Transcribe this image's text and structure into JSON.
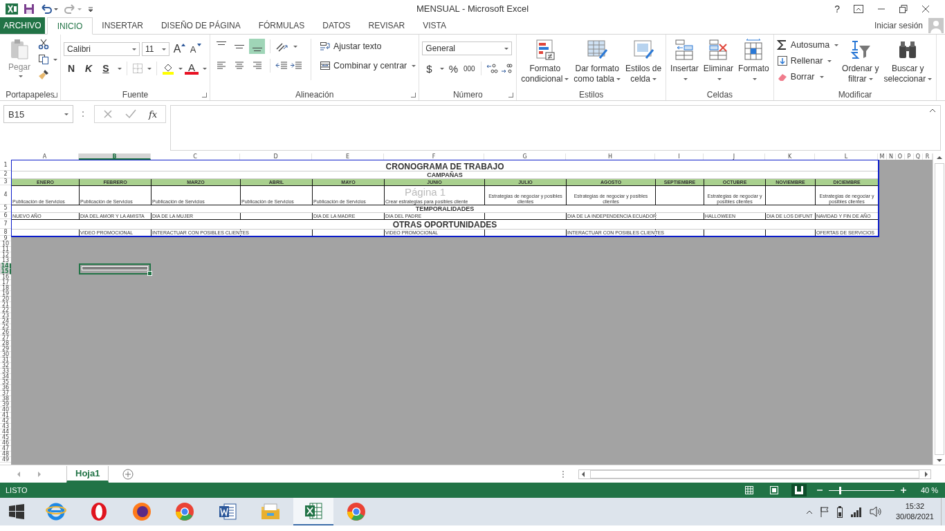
{
  "title_bar": {
    "title": "MENSUAL - Microsoft Excel",
    "help": "?"
  },
  "tabs": [
    {
      "label": "ARCHIVO",
      "kind": "file",
      "selected": false
    },
    {
      "label": "INICIO",
      "kind": "tab",
      "selected": true
    },
    {
      "label": "INSERTAR",
      "kind": "tab",
      "selected": false
    },
    {
      "label": "DISEÑO DE PÁGINA",
      "kind": "tab",
      "selected": false
    },
    {
      "label": "FÓRMULAS",
      "kind": "tab",
      "selected": false
    },
    {
      "label": "DATOS",
      "kind": "tab",
      "selected": false
    },
    {
      "label": "REVISAR",
      "kind": "tab",
      "selected": false
    },
    {
      "label": "VISTA",
      "kind": "tab",
      "selected": false
    }
  ],
  "account": {
    "label": "Iniciar sesión"
  },
  "ribbon": {
    "clipboard": {
      "paste": "Pegar",
      "label": "Portapapeles"
    },
    "font": {
      "family": "Calibri",
      "size": "11",
      "grow": "A",
      "shrink": "A",
      "styles": [
        "N",
        "K",
        "S"
      ],
      "color_letter": "A",
      "label": "Fuente"
    },
    "alignment": {
      "buttons": [
        {
          "kind": "top",
          "selected": false
        },
        {
          "kind": "middle",
          "selected": false
        },
        {
          "kind": "bottom",
          "selected": true
        },
        {
          "kind": "left",
          "selected": false
        },
        {
          "kind": "center",
          "selected": false
        },
        {
          "kind": "right",
          "selected": false
        }
      ],
      "wrap": "Ajustar texto",
      "merge": "Combinar y centrar",
      "label": "Alineación"
    },
    "number": {
      "format": "General",
      "buttons": [
        "$",
        "%",
        "000"
      ],
      "label": "Número"
    },
    "styles": {
      "buttons": [
        {
          "kind": "conditional",
          "lines": [
            "Formato",
            "condicional"
          ]
        },
        {
          "kind": "table",
          "lines": [
            "Dar formato",
            "como tabla"
          ]
        },
        {
          "kind": "cell",
          "lines": [
            "Estilos de",
            "celda"
          ]
        }
      ],
      "label": "Estilos"
    },
    "cells": {
      "buttons": [
        {
          "kind": "insert",
          "label": "Insertar"
        },
        {
          "kind": "delete",
          "label": "Eliminar"
        },
        {
          "kind": "format",
          "label": "Formato"
        }
      ],
      "label": "Celdas"
    },
    "editing": {
      "small": [
        {
          "kind": "sum",
          "label": "Autosuma"
        },
        {
          "kind": "fill",
          "label": "Rellenar"
        },
        {
          "kind": "clear",
          "label": "Borrar"
        }
      ],
      "big": [
        {
          "kind": "sort",
          "lines": [
            "Ordenar y",
            "filtrar"
          ]
        },
        {
          "kind": "find",
          "lines": [
            "Buscar y",
            "seleccionar"
          ]
        }
      ],
      "label": "Modificar"
    }
  },
  "formula_bar": {
    "name_box": "B15",
    "fx": "fx"
  },
  "sheet": {
    "columns": [
      {
        "label": "A",
        "selected": false
      },
      {
        "label": "B",
        "selected": true
      },
      {
        "label": "C",
        "selected": false
      },
      {
        "label": "D",
        "selected": false
      },
      {
        "label": "E",
        "selected": false
      },
      {
        "label": "F",
        "selected": false
      },
      {
        "label": "G",
        "selected": false
      },
      {
        "label": "H",
        "selected": false
      },
      {
        "label": "I",
        "selected": false
      },
      {
        "label": "J",
        "selected": false
      },
      {
        "label": "K",
        "selected": false
      },
      {
        "label": "L",
        "selected": false
      },
      {
        "label": "M",
        "selected": false
      },
      {
        "label": "N",
        "selected": false
      },
      {
        "label": "O",
        "selected": false
      },
      {
        "label": "P",
        "selected": false
      },
      {
        "label": "Q",
        "selected": false
      },
      {
        "label": "R",
        "selected": false
      }
    ],
    "row_numbers": [
      {
        "label": "1",
        "selected": false
      },
      {
        "label": "2",
        "selected": false
      },
      {
        "label": "3",
        "selected": false
      },
      {
        "label": "4",
        "selected": false
      },
      {
        "label": "5",
        "selected": false
      },
      {
        "label": "6",
        "selected": false
      },
      {
        "label": "7",
        "selected": false
      },
      {
        "label": "8",
        "selected": false
      },
      {
        "label": "9",
        "selected": false
      },
      {
        "label": "10",
        "selected": false
      },
      {
        "label": "11",
        "selected": false
      },
      {
        "label": "12",
        "selected": false
      },
      {
        "label": "13",
        "selected": false
      },
      {
        "label": "14",
        "selected": true
      },
      {
        "label": "15",
        "selected": true
      },
      {
        "label": "16",
        "selected": false
      },
      {
        "label": "17",
        "selected": false
      },
      {
        "label": "18",
        "selected": false
      },
      {
        "label": "19",
        "selected": false
      },
      {
        "label": "20",
        "selected": false
      },
      {
        "label": "21",
        "selected": false
      },
      {
        "label": "22",
        "selected": false
      },
      {
        "label": "23",
        "selected": false
      },
      {
        "label": "24",
        "selected": false
      },
      {
        "label": "25",
        "selected": false
      },
      {
        "label": "26",
        "selected": false
      },
      {
        "label": "27",
        "selected": false
      },
      {
        "label": "28",
        "selected": false
      },
      {
        "label": "29",
        "selected": false
      },
      {
        "label": "30",
        "selected": false
      },
      {
        "label": "31",
        "selected": false
      },
      {
        "label": "32",
        "selected": false
      },
      {
        "label": "33",
        "selected": false
      },
      {
        "label": "34",
        "selected": false
      },
      {
        "label": "35",
        "selected": false
      },
      {
        "label": "36",
        "selected": false
      },
      {
        "label": "37",
        "selected": false
      },
      {
        "label": "38",
        "selected": false
      },
      {
        "label": "39",
        "selected": false
      },
      {
        "label": "40",
        "selected": false
      },
      {
        "label": "41",
        "selected": false
      },
      {
        "label": "42",
        "selected": false
      },
      {
        "label": "43",
        "selected": false
      },
      {
        "label": "44",
        "selected": false
      },
      {
        "label": "45",
        "selected": false
      },
      {
        "label": "46",
        "selected": false
      },
      {
        "label": "47",
        "selected": false
      },
      {
        "label": "48",
        "selected": false
      },
      {
        "label": "49",
        "selected": false
      }
    ],
    "rows": [
      {
        "kind": "title",
        "text": "CRONOGRAMA DE TRABAJO"
      },
      {
        "kind": "section",
        "text": "CAMPAÑAS"
      },
      {
        "kind": "header",
        "cells": [
          "ENERO",
          "FEBRERO",
          "MARZO",
          "ABRIL",
          "MAYO",
          "JUNIO",
          "JULIO",
          "AGOSTO",
          "SEPTIEMBRE",
          "OCTUBRE",
          "NOVIEMBRE",
          "DICIEMBRE"
        ]
      },
      {
        "kind": "text",
        "cells": [
          "Publicación de Servicios",
          "Publicación de Servicios",
          "Publicación de Servicios",
          "Publicación de Servicios",
          "Publicación de Servicios",
          "Crear estrategias para posibles cliente",
          "Estrategias de negociar y posibles clientes",
          "Estrategias de negociar y posibles clientes",
          null,
          "Estrategias de negociar y posibles clientes",
          null,
          "Estrategias de negociar y posibles clientes"
        ]
      },
      {
        "kind": "section",
        "text": "TEMPORALIDADES"
      },
      {
        "kind": "caps",
        "cells": [
          "NUEVO AÑO",
          "DIA DEL AMOR Y LA AMISTA",
          "DIA DE LA MUJER",
          null,
          "DIA DE LA MADRE",
          "DIA DEL PADRE",
          null,
          "DIA DE LA INDEPENDENCIA ECUADOR",
          null,
          "HALLOWEEN",
          "DIA DE LOS DIFUNT",
          "NAVIDAD Y FIN DE AÑO"
        ]
      },
      {
        "kind": "title",
        "text": "OTRAS OPORTUNIDADES"
      },
      {
        "kind": "caps",
        "cells": [
          null,
          "VIDEO PROMOCIONAL",
          "INTERACTUAR CON POSIBLES CLIENTES",
          null,
          null,
          "VIDEO PROMOCIONAL",
          null,
          "INTERACTUAR CON POSIBLES CLIENTES",
          null,
          null,
          null,
          "OFERTAS DE SERVICIOS"
        ]
      }
    ],
    "page_label": "Página 1"
  },
  "sheet_tabs": [
    {
      "label": "Hoja1",
      "selected": true
    }
  ],
  "status_bar": {
    "status": "LISTO",
    "views": [
      {
        "kind": "normal",
        "selected": false
      },
      {
        "kind": "layout",
        "selected": false
      },
      {
        "kind": "break",
        "selected": true
      }
    ],
    "zoom": {
      "level": 0.16,
      "label": "40 %"
    }
  },
  "taskbar": {
    "apps": [
      {
        "kind": "ie",
        "selected": false
      },
      {
        "kind": "opera",
        "selected": false
      },
      {
        "kind": "firefox",
        "selected": false
      },
      {
        "kind": "chrome",
        "selected": false
      },
      {
        "kind": "word",
        "selected": false
      },
      {
        "kind": "explorer",
        "selected": false
      },
      {
        "kind": "excel",
        "selected": true
      },
      {
        "kind": "chrome",
        "selected": false
      }
    ],
    "time": "15:32",
    "date": "30/08/2021"
  }
}
